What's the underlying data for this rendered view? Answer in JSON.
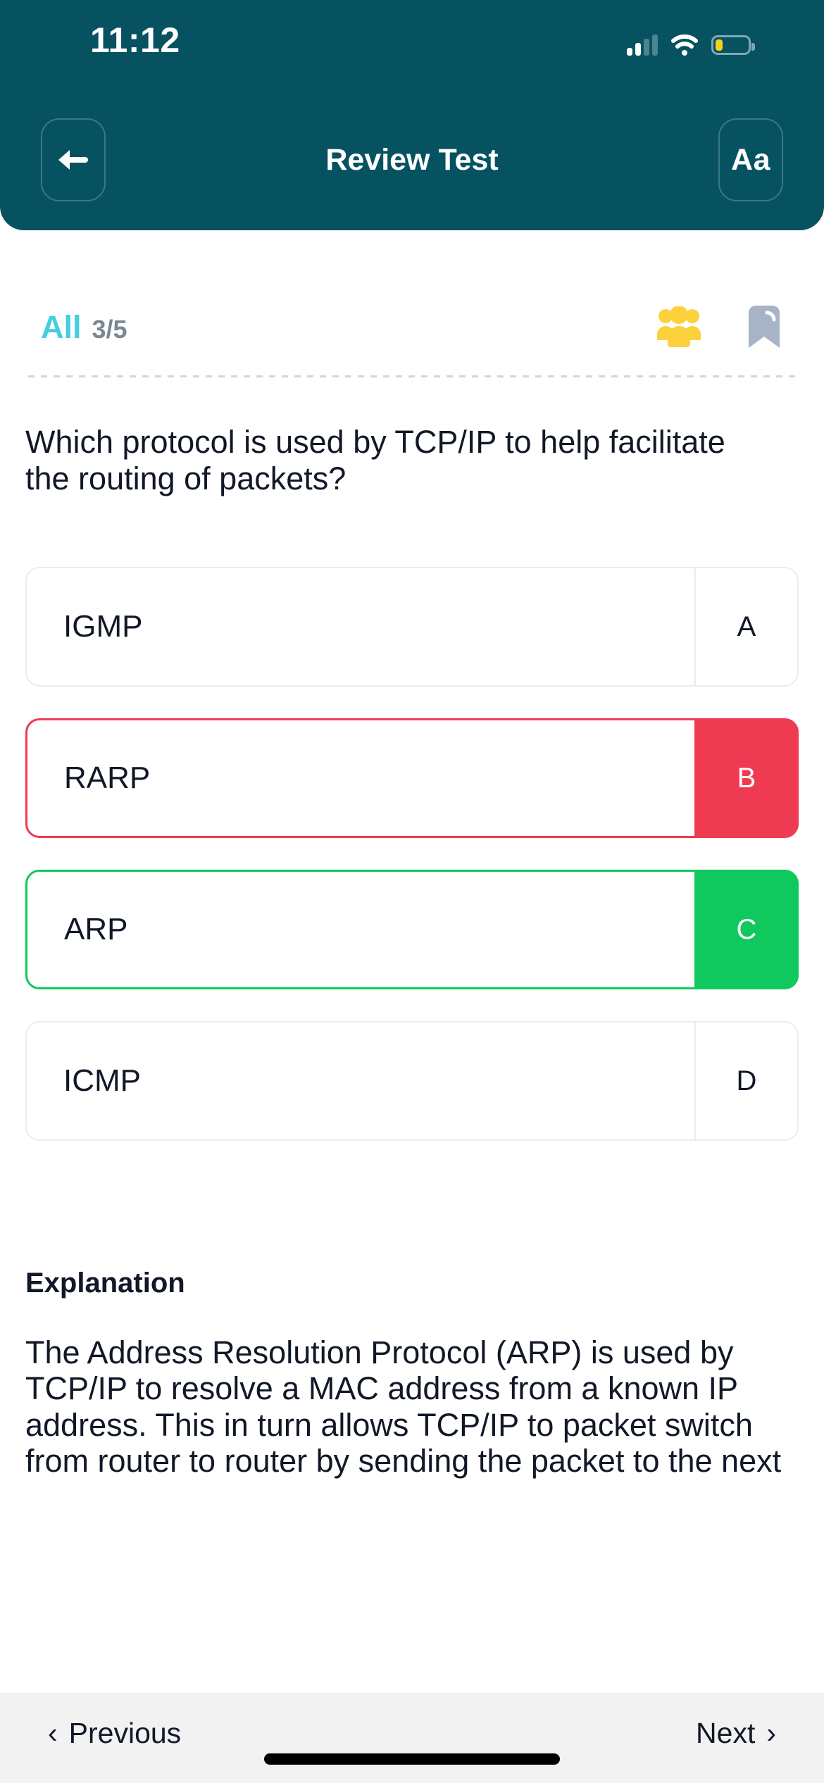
{
  "status_bar": {
    "time": "11:12",
    "cellular_icon": "cellular-signal-icon",
    "wifi_icon": "wifi-icon",
    "battery_icon": "battery-low-icon"
  },
  "header": {
    "title": "Review Test",
    "back_icon": "arrow-left-icon",
    "font_size_label": "Aa",
    "background_color": "#065260"
  },
  "filter_row": {
    "scope_label": "All",
    "progress": "3/5",
    "scope_color": "#44CEDE",
    "progress_color": "#7B8794",
    "group_icon": "people-group-icon",
    "group_icon_color": "#FCD13C",
    "bookmark_icon": "bookmark-icon",
    "bookmark_icon_color": "#A7B4C6"
  },
  "question": {
    "text": "Which protocol is used by TCP/IP to help facilitate the routing of packets?"
  },
  "options": [
    {
      "letter": "A",
      "text": "IGMP",
      "state": "neutral",
      "color": "#E7ECF4"
    },
    {
      "letter": "B",
      "text": "RARP",
      "state": "wrong",
      "color": "#EF3B52"
    },
    {
      "letter": "C",
      "text": "ARP",
      "state": "right",
      "color": "#10C95E"
    },
    {
      "letter": "D",
      "text": "ICMP",
      "state": "neutral",
      "color": "#E7ECF4"
    }
  ],
  "explanation": {
    "heading": "Explanation",
    "body": "The Address Resolution Protocol (ARP) is used by TCP/IP to resolve a MAC address from a known IP address. This in turn allows TCP/IP to packet switch from router to router by sending the packet to the next"
  },
  "bottom_bar": {
    "previous_label": "Previous",
    "next_label": "Next",
    "previous_chevron": "chevron-left-icon",
    "next_chevron": "chevron-right-icon",
    "background_color": "#F2F2F2"
  }
}
